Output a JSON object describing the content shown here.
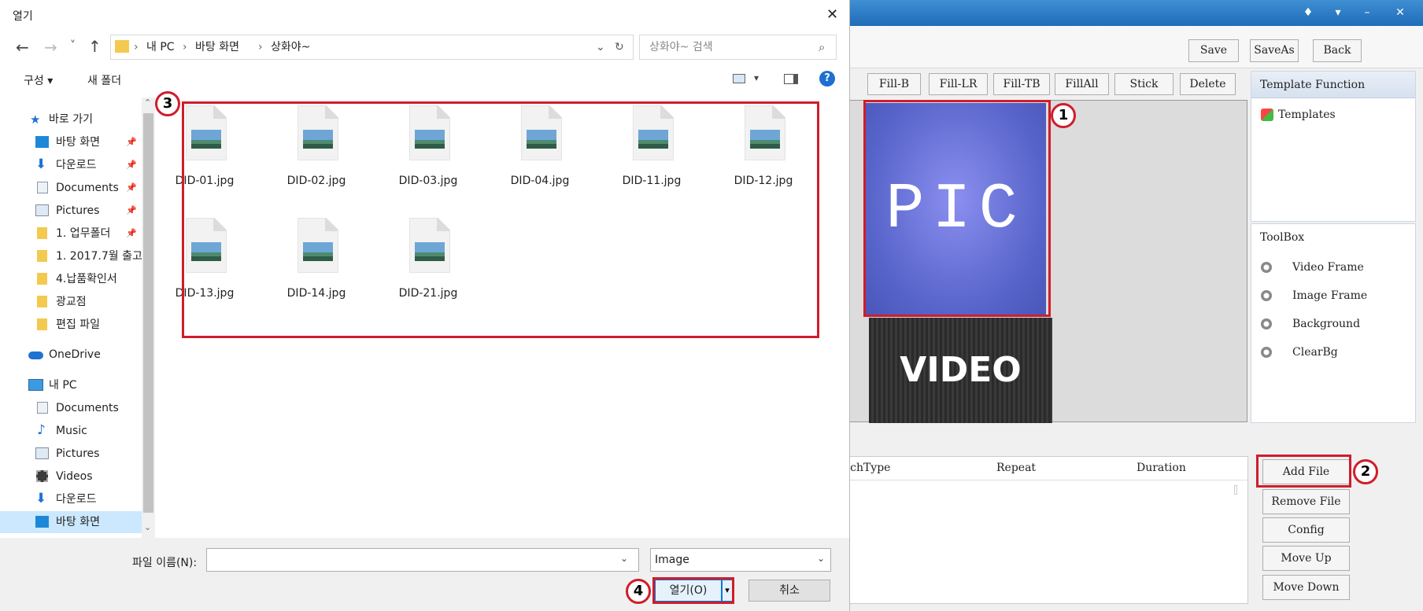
{
  "dialog": {
    "title": "열기",
    "close_glyph": "✕",
    "nav_back": "←",
    "nav_forward": "→",
    "nav_recent": "˅",
    "nav_up": "↑",
    "breadcrumb": [
      "내 PC",
      "바탕 화면",
      "상화야~"
    ],
    "breadcrumb_sep": "›",
    "search_placeholder": "상화야~ 검색",
    "organize_label": "구성 ▾",
    "new_folder_label": "새 폴더",
    "nav_pane": [
      {
        "label": "바로 가기",
        "icon": "star-icon"
      },
      {
        "label": "바탕 화면",
        "icon": "desktop-icon",
        "pinned": true
      },
      {
        "label": "다운로드",
        "icon": "download-icon",
        "pinned": true
      },
      {
        "label": "Documents",
        "icon": "document-icon",
        "pinned": true
      },
      {
        "label": "Pictures",
        "icon": "pictures-icon",
        "pinned": true
      },
      {
        "label": "1. 업무폴더",
        "icon": "folder-icon",
        "pinned": true
      },
      {
        "label": "1. 2017.7월 출고",
        "icon": "folder-icon"
      },
      {
        "label": "4.납품확인서",
        "icon": "folder-icon"
      },
      {
        "label": "광교점",
        "icon": "folder-icon"
      },
      {
        "label": "편집 파일",
        "icon": "folder-icon"
      },
      {
        "label": "OneDrive",
        "icon": "cloud-icon"
      },
      {
        "label": "내 PC",
        "icon": "pc-icon"
      },
      {
        "label": "Documents",
        "icon": "document-icon"
      },
      {
        "label": "Music",
        "icon": "music-icon"
      },
      {
        "label": "Pictures",
        "icon": "pictures-icon"
      },
      {
        "label": "Videos",
        "icon": "video-icon"
      },
      {
        "label": "다운로드",
        "icon": "download-icon"
      },
      {
        "label": "바탕 화면",
        "icon": "desktop-icon",
        "selected": true
      }
    ],
    "files": [
      "DID-01.jpg",
      "DID-02.jpg",
      "DID-03.jpg",
      "DID-04.jpg",
      "DID-11.jpg",
      "DID-12.jpg",
      "DID-13.jpg",
      "DID-14.jpg",
      "DID-21.jpg"
    ],
    "filename_label": "파일 이름(N):",
    "filename_value": "",
    "filetype_value": "Image",
    "open_label": "열기(O)",
    "cancel_label": "취소"
  },
  "app": {
    "toolbar": {
      "save": "Save",
      "save_as": "SaveAs",
      "back": "Back"
    },
    "fill_buttons": [
      "Fill-B",
      "Fill-LR",
      "Fill-TB",
      "FillAll",
      "Stick",
      "Delete"
    ],
    "canvas": {
      "pic_text": "PIC",
      "video_text": "VIDEO"
    },
    "template_panel": {
      "title": "Template Function",
      "item": "Templates"
    },
    "toolbox": {
      "title": "ToolBox",
      "items": [
        "Video Frame",
        "Image Frame",
        "Background",
        "ClearBg"
      ]
    },
    "file_list": {
      "columns": [
        "itchType",
        "Repeat",
        "Duration"
      ]
    },
    "side_buttons": [
      "Add File",
      "Remove File",
      "Config",
      "Move Up",
      "Move Down"
    ]
  },
  "annotations": [
    "1",
    "2",
    "3",
    "4"
  ],
  "colors": {
    "highlight": "#d11c2b",
    "titlebar": "#2b7cc9",
    "selection": "#cce8ff"
  }
}
